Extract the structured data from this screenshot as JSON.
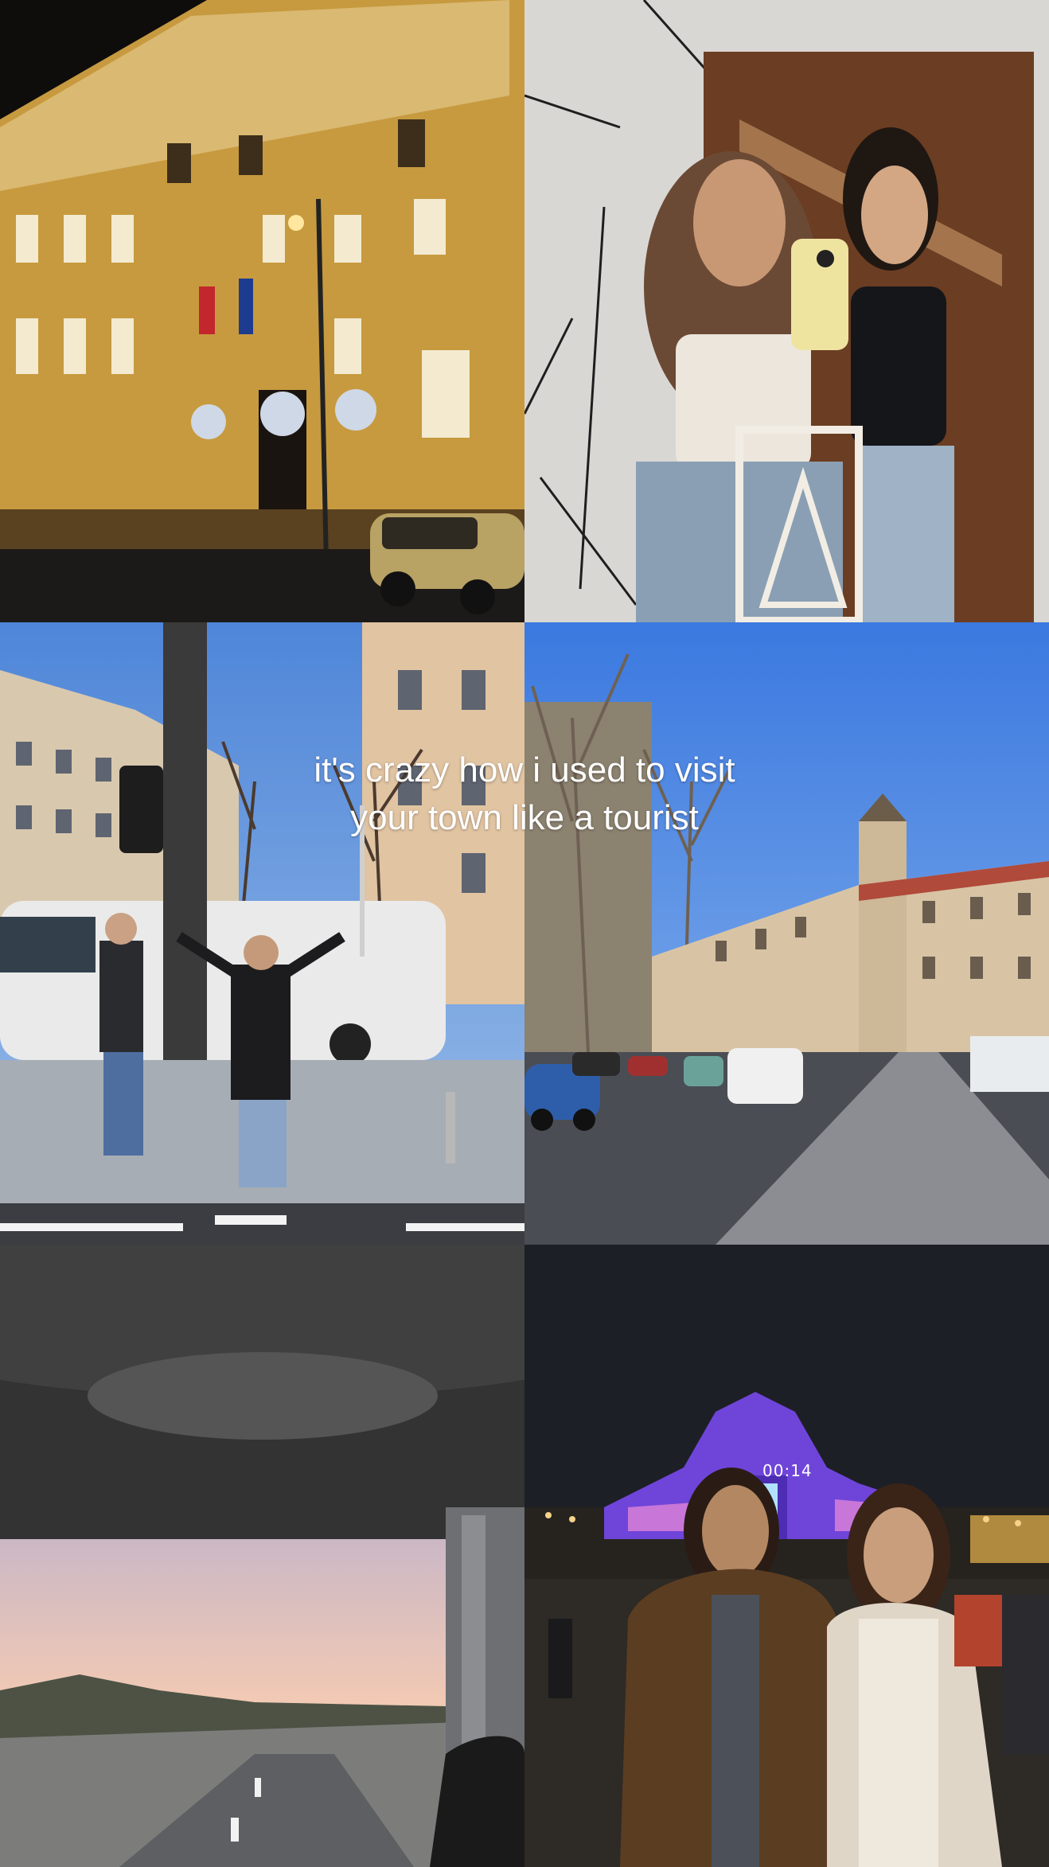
{
  "overlay": {
    "caption_line_1": "it's crazy how i used to visit",
    "caption_line_2": "your town like a tourist"
  },
  "tiles": [
    {
      "id": "building-night-photo"
    },
    {
      "id": "mirror-selfie-photo"
    },
    {
      "id": "street-waving-photo"
    },
    {
      "id": "boulevard-photo"
    },
    {
      "id": "bus-window-highway-photo"
    },
    {
      "id": "light-festival-selfie-photo"
    }
  ],
  "festival": {
    "timer_text": "00:14"
  }
}
